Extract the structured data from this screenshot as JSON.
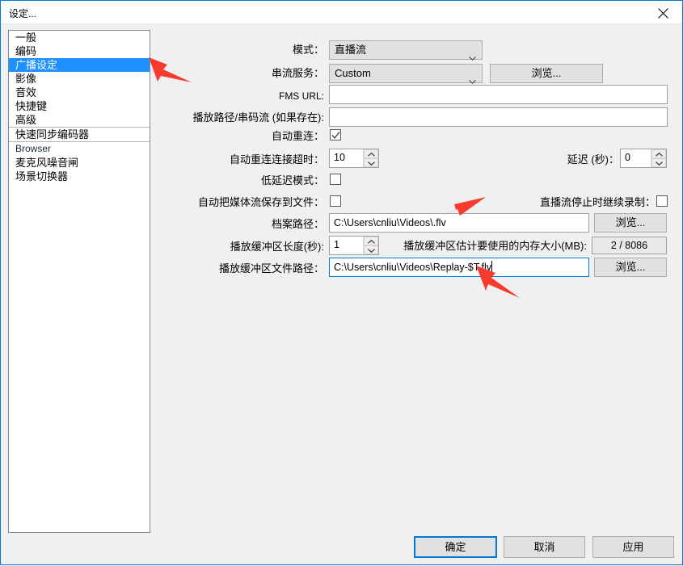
{
  "window": {
    "title": "设定...",
    "close_icon": "close-icon"
  },
  "sidebar": {
    "items": [
      {
        "label": "一般",
        "selected": false
      },
      {
        "label": "编码",
        "selected": false
      },
      {
        "label": "广播设定",
        "selected": true
      },
      {
        "label": "影像",
        "selected": false
      },
      {
        "label": "音效",
        "selected": false
      },
      {
        "label": "快捷键",
        "selected": false
      },
      {
        "label": "高级",
        "selected": false
      },
      {
        "label": "快速同步编码器",
        "selected": false
      },
      {
        "label": "Browser",
        "selected": false
      },
      {
        "label": "麦克风噪音闸",
        "selected": false
      },
      {
        "label": "场景切换器",
        "selected": false
      }
    ]
  },
  "form": {
    "mode": {
      "label": "模式：",
      "value": "直播流",
      "chevron_icon": "chevron-down-icon"
    },
    "stream_service": {
      "label": "串流服务：",
      "value": "Custom",
      "chevron_icon": "chevron-down-icon"
    },
    "browse_service": {
      "label": "浏览..."
    },
    "fms_url": {
      "label": "FMS URL:",
      "value": "",
      "placeholder": ""
    },
    "play_path": {
      "label": "播放路径/串码流 (如果存在):",
      "value": "",
      "placeholder": ""
    },
    "auto_reconnect": {
      "label": "自动重连：",
      "checked": true,
      "check_icon": "check-icon"
    },
    "reconnect_timeout": {
      "label": "自动重连连接超时：",
      "value": "10",
      "up_icon": "spinner-up-icon",
      "down_icon": "spinner-down-icon"
    },
    "delay": {
      "label": "延迟 (秒)：",
      "value": "0",
      "up_icon": "spinner-up-icon",
      "down_icon": "spinner-down-icon"
    },
    "low_latency": {
      "label": "低延迟模式：",
      "checked": false
    },
    "auto_save_stream": {
      "label": "自动把媒体流保存到文件：",
      "checked": false
    },
    "keep_recording": {
      "label": "直播流停止时继续录制：",
      "checked": false
    },
    "file_path": {
      "label": "档案路径：",
      "value": "C:\\Users\\cnliu\\Videos\\.flv",
      "browse_label": "浏览..."
    },
    "replay_buffer_length": {
      "label": "播放缓冲区长度(秒):",
      "value": "1",
      "up_icon": "spinner-up-icon",
      "down_icon": "spinner-down-icon"
    },
    "replay_buffer_memory": {
      "label": "播放缓冲区估计要使用的内存大小(MB):",
      "value": "2 / 8086"
    },
    "replay_buffer_path": {
      "label": "播放缓冲区文件路径：",
      "value": "C:\\Users\\cnliu\\Videos\\Replay-$T.flv",
      "browse_label": "浏览...",
      "focused": true
    }
  },
  "footer": {
    "ok": "确定",
    "cancel": "取消",
    "apply": "应用"
  },
  "annotations": {
    "arrow_color": "#f93a2f",
    "arrows": [
      {
        "name": "arrow-to-broadcast-settings"
      },
      {
        "name": "arrow-to-file-path"
      },
      {
        "name": "arrow-to-replay-buffer-path"
      }
    ]
  }
}
